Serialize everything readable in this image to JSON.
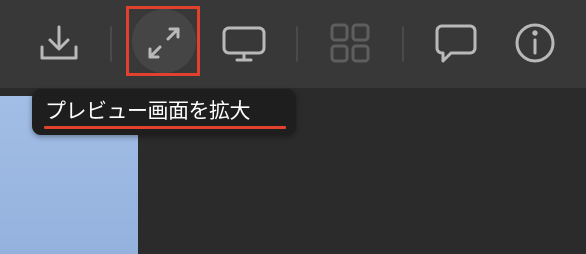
{
  "toolbar": {
    "icons": [
      {
        "name": "download-icon",
        "interactable": true
      },
      {
        "name": "expand-preview-icon",
        "interactable": true,
        "highlighted": true
      },
      {
        "name": "slideshow-icon",
        "interactable": true
      },
      {
        "name": "grid-view-icon",
        "interactable": false,
        "disabled": true
      },
      {
        "name": "comment-icon",
        "interactable": true
      },
      {
        "name": "info-icon",
        "interactable": true
      }
    ]
  },
  "tooltip": {
    "text": "プレビュー画面を拡大"
  },
  "colors": {
    "toolbar_bg": "#383838",
    "content_bg": "#2b2b2b",
    "icon": "#b9b9b9",
    "icon_disabled": "#5e5e5e",
    "highlight": "#e2412e",
    "thumbnail": "#9ab6e0",
    "tooltip_bg": "#1e1e1e"
  }
}
